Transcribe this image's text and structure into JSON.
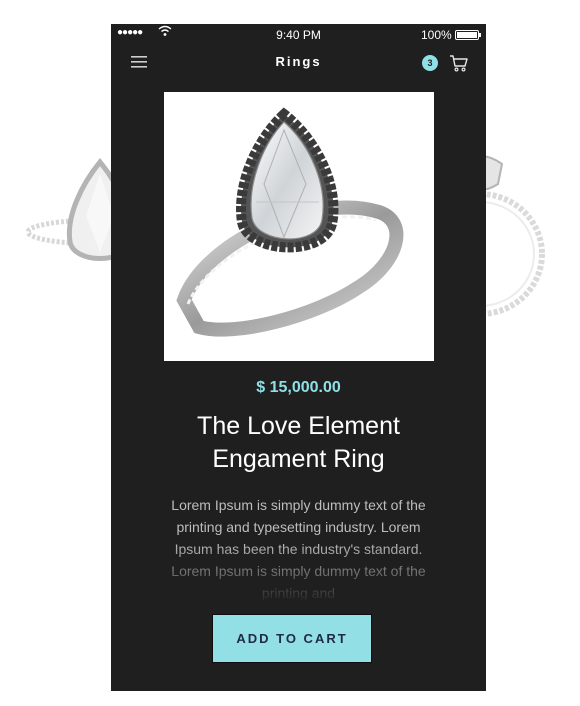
{
  "status_bar": {
    "signal": "●●●●●",
    "time": "9:40 PM",
    "battery": "100%"
  },
  "nav": {
    "title": "Rings",
    "cart_count": "3",
    "icons": [
      "menu-icon",
      "cart-icon"
    ]
  },
  "product": {
    "price": "$ 15,000.00",
    "name": "The Love Element Engament Ring",
    "description": "Lorem Ipsum is simply dummy text of the printing and typesetting industry. Lorem Ipsum has been the industry's standard. Lorem Ipsum is simply dummy text of the printing and",
    "images": [
      "ring-pear-halo-side",
      "ring-pear-halo-main",
      "ring-profile-view"
    ]
  },
  "actions": {
    "add_to_cart": "ADD TO CART"
  },
  "colors": {
    "background": "#1f1f1f",
    "accent": "#8fe0e6",
    "button": "#93dfe6",
    "button_text": "#1f2a44"
  }
}
